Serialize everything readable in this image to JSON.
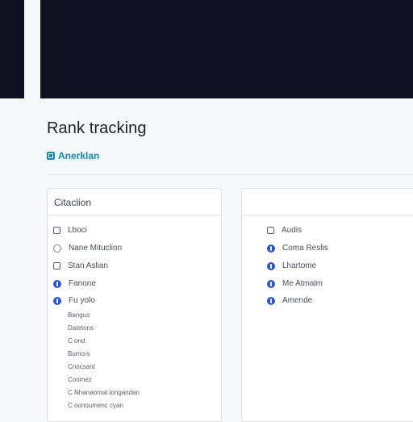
{
  "page": {
    "title": "Rank tracking",
    "crumb_label": "Anerklan"
  },
  "left_card": {
    "title": "Citaclion",
    "options": [
      {
        "label": "Lboci",
        "control": "checkbox",
        "checked": false
      },
      {
        "label": "Nane Mituclion",
        "control": "radio",
        "checked": false
      },
      {
        "label": "Stan Aslian",
        "control": "checkbox",
        "checked": false
      },
      {
        "label": "Fanone",
        "control": "radio",
        "checked": true
      },
      {
        "label": "Fu yolo",
        "control": "radio",
        "checked": true
      }
    ],
    "sub_items": [
      "Banguo",
      "Datetons",
      "C ond",
      "Bumors",
      "Cnocsant",
      "Coomez",
      "C Nhanaomat longandan",
      "C oonoumenc cyan"
    ]
  },
  "right_card": {
    "title": "",
    "options": [
      {
        "label": "Audis",
        "control": "checkbox",
        "checked": false
      },
      {
        "label": "Coma Reslis",
        "control": "radio",
        "checked": true
      },
      {
        "label": "Lhartome",
        "control": "radio",
        "checked": true
      },
      {
        "label": "Me Atmalm",
        "control": "radio",
        "checked": true
      },
      {
        "label": "Amende",
        "control": "radio",
        "checked": true
      }
    ]
  },
  "colors": {
    "topbar": "#0f1020",
    "accent": "#0f8fb8",
    "radio_checked": "#2c55d6"
  }
}
